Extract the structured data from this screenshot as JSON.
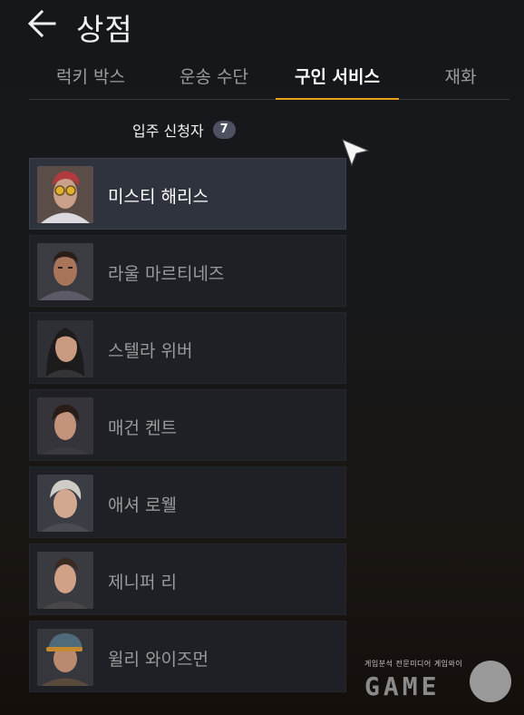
{
  "header": {
    "title": "상점",
    "back_icon": "arrow-left-icon"
  },
  "tabs": [
    {
      "label": "럭키 박스",
      "active": false
    },
    {
      "label": "운송 수단",
      "active": false
    },
    {
      "label": "구인 서비스",
      "active": true
    },
    {
      "label": "재화",
      "active": false
    }
  ],
  "applicants": {
    "label": "입주 신청자",
    "count": "7"
  },
  "characters": [
    {
      "name": "미스티 해리스",
      "selected": true,
      "avatar": "portrait-red-hair-goggles"
    },
    {
      "name": "라울 마르티네즈",
      "selected": false,
      "avatar": "portrait-dark-hair-man"
    },
    {
      "name": "스텔라 위버",
      "selected": false,
      "avatar": "portrait-long-dark-hair-woman"
    },
    {
      "name": "매건 켄트",
      "selected": false,
      "avatar": "portrait-short-dark-hair-woman"
    },
    {
      "name": "애셔 로웰",
      "selected": false,
      "avatar": "portrait-silver-hair-man"
    },
    {
      "name": "제니퍼 리",
      "selected": false,
      "avatar": "portrait-ponytail-woman"
    },
    {
      "name": "윌리 와이즈먼",
      "selected": false,
      "avatar": "portrait-cap-man"
    }
  ],
  "watermark": {
    "caption": "게임분석 전문미디어 게임와이",
    "logo": "GAME"
  },
  "colors": {
    "accent": "#e8a117",
    "badge": "#4e5162",
    "selected_row": "#2e333d",
    "row": "#1e2026"
  }
}
